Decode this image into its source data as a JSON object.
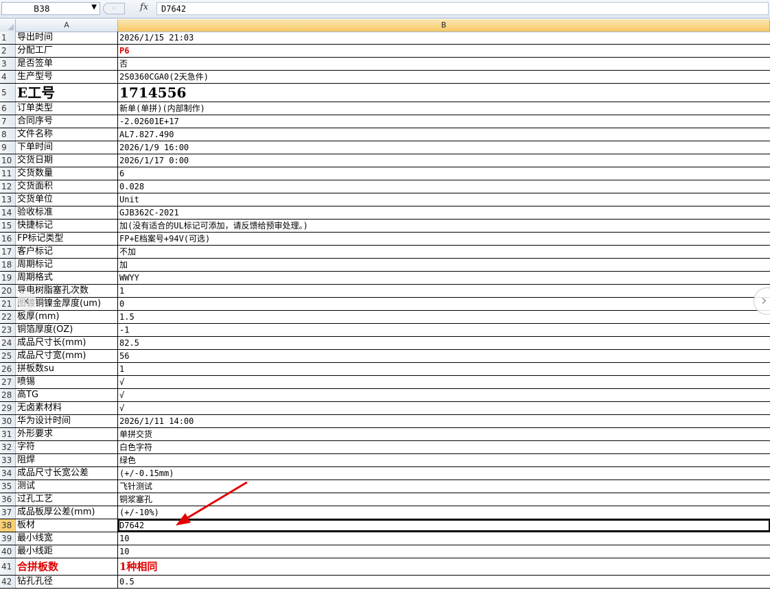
{
  "formula_bar": {
    "name_box": "B38",
    "fx": "fx",
    "formula": "D7642"
  },
  "columns": [
    "A",
    "B"
  ],
  "rows": [
    {
      "n": "1",
      "a": "导出时间",
      "b": "2026/1/15 21:03"
    },
    {
      "n": "2",
      "a": "分配工厂",
      "b": "P6",
      "style": "red"
    },
    {
      "n": "3",
      "a": "是否签单",
      "b": "否"
    },
    {
      "n": "4",
      "a": "生产型号",
      "b": "2S0360CGA0(2天急件)"
    },
    {
      "n": "5",
      "a": "E工号",
      "b": "1714556",
      "style": "big"
    },
    {
      "n": "6",
      "a": "订单类型",
      "b": "新单(单拼)(内部制作)"
    },
    {
      "n": "7",
      "a": "合同序号",
      "b": "-2.02601E+17"
    },
    {
      "n": "8",
      "a": "文件名称",
      "b": "AL7.827.490"
    },
    {
      "n": "9",
      "a": "下单时间",
      "b": "2026/1/9 16:00"
    },
    {
      "n": "10",
      "a": "交货日期",
      "b": "2026/1/17 0:00"
    },
    {
      "n": "11",
      "a": "交货数量",
      "b": "6"
    },
    {
      "n": "12",
      "a": "交货面积",
      "b": "0.028"
    },
    {
      "n": "13",
      "a": "交货单位",
      "b": "Unit"
    },
    {
      "n": "14",
      "a": "验收标准",
      "b": "GJB362C-2021"
    },
    {
      "n": "15",
      "a": "快捷标记",
      "b": "加(没有适合的UL标记可添加，请反馈给预审处理。)"
    },
    {
      "n": "16",
      "a": "FP标记类型",
      "b": "FP+E档案号+94V(可选)"
    },
    {
      "n": "17",
      "a": "客户标记",
      "b": "不加"
    },
    {
      "n": "18",
      "a": "周期标记",
      "b": "加"
    },
    {
      "n": "19",
      "a": "周期格式",
      "b": "WWYY"
    },
    {
      "n": "20",
      "a": "导电树脂塞孔次数",
      "b": "1"
    },
    {
      "n": "21",
      "a": "图镀铜镍金厚度(um)",
      "b": "0"
    },
    {
      "n": "22",
      "a": "板厚(mm)",
      "b": "1.5"
    },
    {
      "n": "23",
      "a": "铜箔厚度(OZ)",
      "b": "-1"
    },
    {
      "n": "24",
      "a": "成品尺寸长(mm)",
      "b": "82.5"
    },
    {
      "n": "25",
      "a": "成品尺寸宽(mm)",
      "b": "56"
    },
    {
      "n": "26",
      "a": "拼板数su",
      "b": "1"
    },
    {
      "n": "27",
      "a": "喷锡",
      "b": "√"
    },
    {
      "n": "28",
      "a": "高TG",
      "b": "√"
    },
    {
      "n": "29",
      "a": "无卤素材料",
      "b": "√"
    },
    {
      "n": "30",
      "a": "华为设计时间",
      "b": "2026/1/11 14:00"
    },
    {
      "n": "31",
      "a": "外形要求",
      "b": "单拼交货"
    },
    {
      "n": "32",
      "a": "字符",
      "b": "白色字符"
    },
    {
      "n": "33",
      "a": "阻焊",
      "b": "绿色"
    },
    {
      "n": "34",
      "a": "成品尺寸长宽公差",
      "b": "(+/-0.15mm)"
    },
    {
      "n": "35",
      "a": "测试",
      "b": "飞针测试"
    },
    {
      "n": "36",
      "a": "过孔工艺",
      "b": "铜浆塞孔"
    },
    {
      "n": "37",
      "a": "成品板厚公差(mm)",
      "b": "(+/-10%)"
    },
    {
      "n": "38",
      "a": "板材",
      "b": "D7642",
      "selected": true
    },
    {
      "n": "39",
      "a": "最小线宽",
      "b": "10"
    },
    {
      "n": "40",
      "a": "最小线距",
      "b": "10"
    },
    {
      "n": "41",
      "a": "合拼板数",
      "b": "1种相同",
      "style": "boldred"
    },
    {
      "n": "42",
      "a": "钻孔孔径",
      "b": "0.5"
    }
  ],
  "nav": {
    "prev_icon": "‹",
    "next_icon": "›"
  },
  "annotation": {
    "type": "red-arrow",
    "color": "#e00000"
  }
}
